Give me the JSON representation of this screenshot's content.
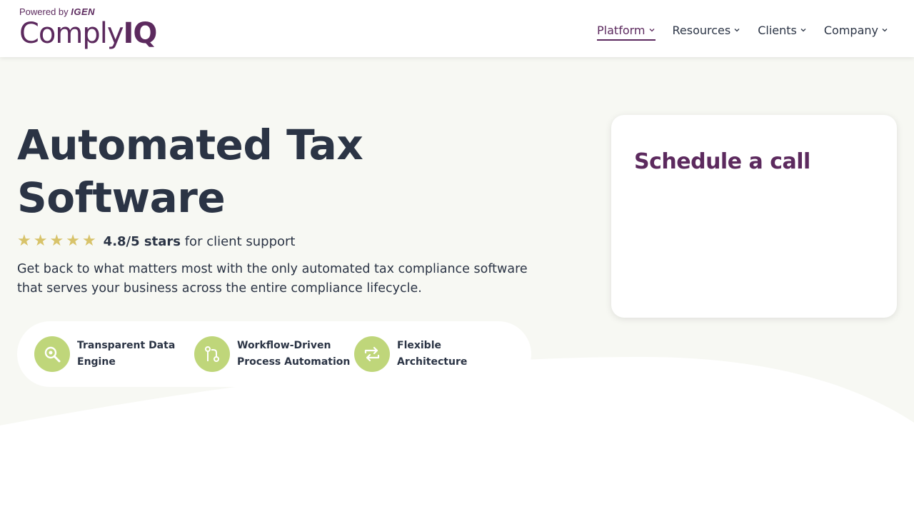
{
  "header": {
    "powered_prefix": "Powered by",
    "powered_brand": "IGEN",
    "logo_main": "Comply",
    "logo_suffix": "IQ",
    "nav": [
      {
        "label": "Platform",
        "active": true
      },
      {
        "label": "Resources",
        "active": false
      },
      {
        "label": "Clients",
        "active": false
      },
      {
        "label": "Company",
        "active": false
      }
    ]
  },
  "hero": {
    "title_line1": "Automated Tax",
    "title_line2": "Software",
    "rating_score": "4.8/5 stars",
    "rating_text": "for client support",
    "stars": 5,
    "description": "Get back to what matters most with the only automated tax compliance software that serves your business across the entire compliance lifecycle.",
    "features": [
      {
        "label": "Transparent Data Engine",
        "icon": "search-gear-icon"
      },
      {
        "label": "Workflow-Driven Process Automation",
        "icon": "workflow-branch-icon"
      },
      {
        "label": "Flexible Architecture",
        "icon": "repeat-arrows-icon"
      }
    ]
  },
  "card": {
    "title": "Schedule a call"
  },
  "colors": {
    "brand_purple": "#5c2a5e",
    "text_dark": "#2b3445",
    "accent_green": "#bfd67a",
    "star_gold": "#d8c36a",
    "hero_bg": "#f7f8f3"
  }
}
